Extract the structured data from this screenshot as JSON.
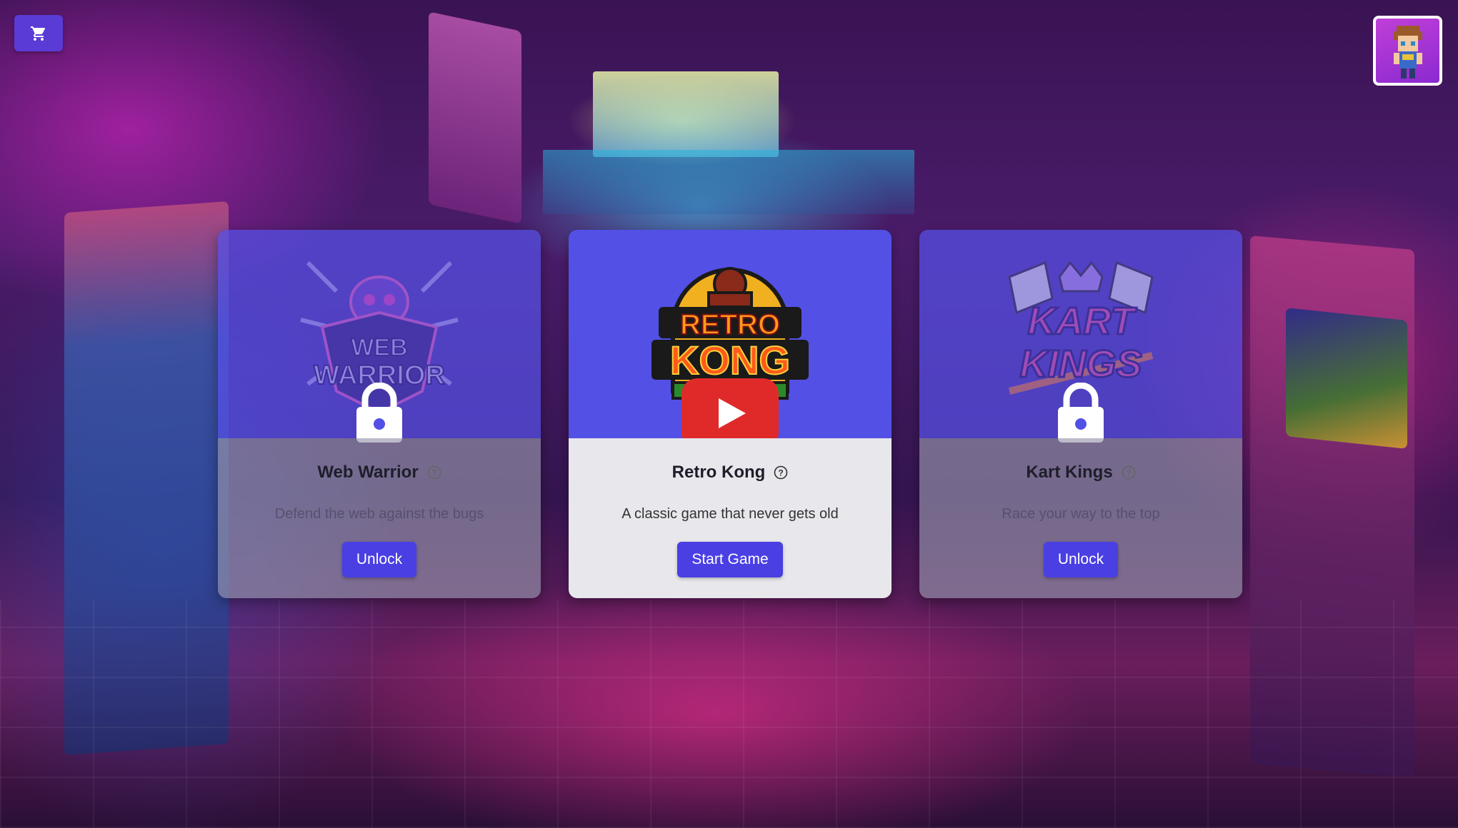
{
  "header": {
    "cart_icon": "cart-icon",
    "avatar_icon": "pixel-hero-avatar"
  },
  "games": [
    {
      "title": "Web Warrior",
      "description": "Defend the web against the bugs",
      "action_label": "Unlock",
      "locked": true,
      "logo_text": [
        "WEB",
        "WARRIOR"
      ],
      "icon": "lock-icon"
    },
    {
      "title": "Retro Kong",
      "description": "A classic game that never gets old",
      "action_label": "Start Game",
      "locked": false,
      "logo_text": [
        "RETRO",
        "KONG"
      ],
      "icon": "play-icon"
    },
    {
      "title": "Kart Kings",
      "description": "Race your way to the top",
      "action_label": "Unlock",
      "locked": true,
      "logo_text": [
        "KART",
        "KINGS"
      ],
      "icon": "lock-icon"
    }
  ],
  "colors": {
    "accent": "#4a3fe3",
    "banner": "#5350e6",
    "play_red": "#e02a2a",
    "card_body": "#e7e7ec"
  }
}
